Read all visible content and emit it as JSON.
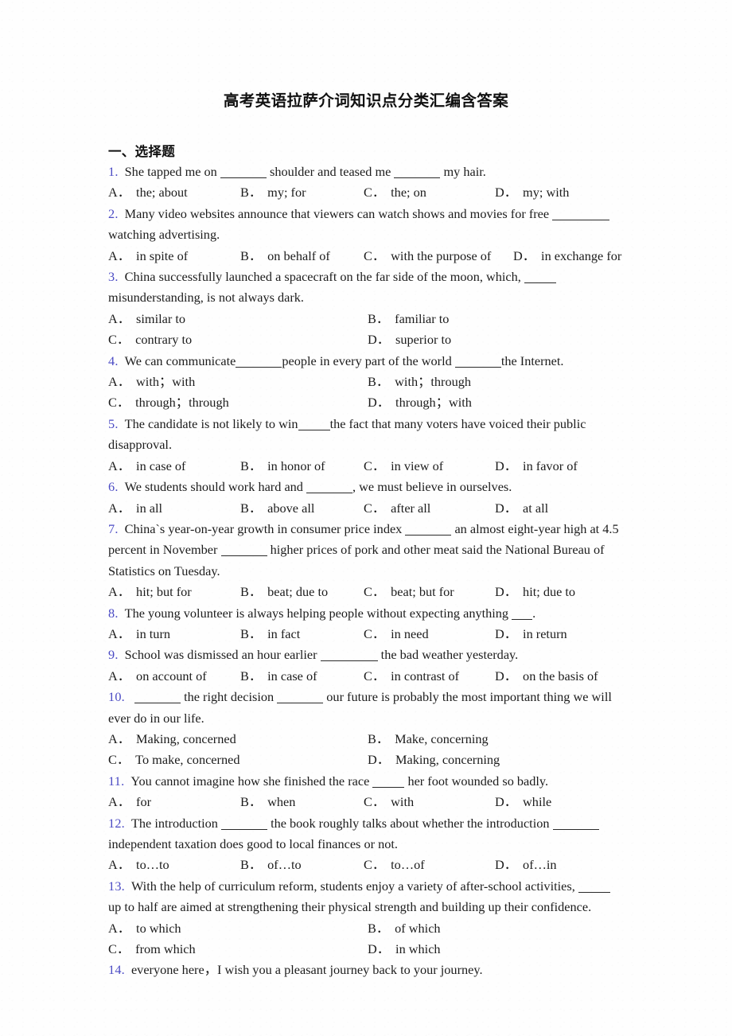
{
  "document": {
    "title": "高考英语拉萨介词知识点分类汇编含答案",
    "section_heading": "一、选择题"
  },
  "questions": [
    {
      "number": "1.",
      "stem_parts": [
        "She tapped me on ",
        " shoulder and teased me ",
        " my hair."
      ],
      "blanks": [
        "blank-m",
        "blank-m"
      ],
      "layout": "cols4",
      "options": [
        {
          "letter": "A．",
          "text": "the; about"
        },
        {
          "letter": "B．",
          "text": "my; for"
        },
        {
          "letter": "C．",
          "text": "the; on"
        },
        {
          "letter": "D．",
          "text": "my; with"
        }
      ]
    },
    {
      "number": "2.",
      "stem_parts": [
        "Many video websites announce that viewers can watch shows and movies for free ",
        " watching advertising."
      ],
      "blanks": [
        "blank-l"
      ],
      "layout": "cols4tight",
      "options": [
        {
          "letter": "A．",
          "text": "in spite of"
        },
        {
          "letter": "B．",
          "text": "on behalf of"
        },
        {
          "letter": "C．",
          "text": "with the purpose of"
        },
        {
          "letter": "D．",
          "text": "in exchange for"
        }
      ]
    },
    {
      "number": "3.",
      "stem_parts": [
        "China successfully launched a spacecraft on the far side of the moon, which, ",
        " misunderstanding, is not always dark."
      ],
      "blanks": [
        "blank-s"
      ],
      "layout": "cols2",
      "options": [
        {
          "letter": "A．",
          "text": "similar to"
        },
        {
          "letter": "B．",
          "text": "familiar to"
        },
        {
          "letter": "C．",
          "text": "contrary to"
        },
        {
          "letter": "D．",
          "text": "superior to"
        }
      ]
    },
    {
      "number": "4.",
      "stem_parts": [
        "We can communicate",
        "people in every part of the world ",
        "the Internet."
      ],
      "blanks": [
        "blank-m",
        "blank-m"
      ],
      "layout": "cols2",
      "options": [
        {
          "letter": "A．",
          "text": "with；with"
        },
        {
          "letter": "B．",
          "text": "with；through"
        },
        {
          "letter": "C．",
          "text": "through；through"
        },
        {
          "letter": "D．",
          "text": "through；with"
        }
      ]
    },
    {
      "number": "5.",
      "stem_parts": [
        "The candidate is not likely to win",
        "the fact that many voters have voiced their public disapproval."
      ],
      "blanks": [
        "blank-s"
      ],
      "layout": "cols4",
      "options": [
        {
          "letter": "A．",
          "text": "in case of"
        },
        {
          "letter": "B．",
          "text": "in honor of"
        },
        {
          "letter": "C．",
          "text": "in view of"
        },
        {
          "letter": "D．",
          "text": "in favor of"
        }
      ]
    },
    {
      "number": "6.",
      "stem_parts": [
        "We students should work hard and ",
        ", we must believe in ourselves."
      ],
      "blanks": [
        "blank-m"
      ],
      "layout": "cols4",
      "options": [
        {
          "letter": "A．",
          "text": "in all"
        },
        {
          "letter": "B．",
          "text": "above all"
        },
        {
          "letter": "C．",
          "text": "after all"
        },
        {
          "letter": "D．",
          "text": "at all"
        }
      ]
    },
    {
      "number": "7.",
      "stem_parts": [
        "China`s year-on-year growth in consumer price index ",
        " an almost eight-year high at 4.5 percent in November ",
        " higher prices of pork and other meat said the National Bureau of Statistics on Tuesday."
      ],
      "blanks": [
        "blank-m",
        "blank-m"
      ],
      "layout": "cols4",
      "options": [
        {
          "letter": "A．",
          "text": "hit; but for"
        },
        {
          "letter": "B．",
          "text": "beat; due to"
        },
        {
          "letter": "C．",
          "text": "beat; but for"
        },
        {
          "letter": "D．",
          "text": "hit; due to"
        }
      ]
    },
    {
      "number": "8.",
      "stem_parts": [
        "The young volunteer is always helping people without expecting anything ",
        "."
      ],
      "blanks": [
        "blank-xs"
      ],
      "layout": "cols4",
      "options": [
        {
          "letter": "A．",
          "text": "in turn"
        },
        {
          "letter": "B．",
          "text": "in fact"
        },
        {
          "letter": "C．",
          "text": "in need"
        },
        {
          "letter": "D．",
          "text": "in return"
        }
      ]
    },
    {
      "number": "9.",
      "stem_parts": [
        "School was dismissed an hour earlier ",
        " the bad weather yesterday."
      ],
      "blanks": [
        "blank-l"
      ],
      "layout": "cols4",
      "options": [
        {
          "letter": "A．",
          "text": "on account of"
        },
        {
          "letter": "B．",
          "text": "in case of"
        },
        {
          "letter": "C．",
          "text": "in contrast of"
        },
        {
          "letter": "D．",
          "text": "on the basis of"
        }
      ]
    },
    {
      "number": "10.",
      "stem_parts": [
        " ",
        " the right decision ",
        " our future is probably the most important thing we will ever do in our life."
      ],
      "blanks": [
        "blank-m",
        "blank-m"
      ],
      "layout": "cols2",
      "options": [
        {
          "letter": "A．",
          "text": "Making, concerned"
        },
        {
          "letter": "B．",
          "text": "Make, concerning"
        },
        {
          "letter": "C．",
          "text": "To make, concerned"
        },
        {
          "letter": "D．",
          "text": "Making, concerning"
        }
      ]
    },
    {
      "number": "11.",
      "stem_parts": [
        "You cannot imagine how she finished the race ",
        " her foot wounded so badly."
      ],
      "blanks": [
        "blank-s"
      ],
      "layout": "cols4",
      "options": [
        {
          "letter": "A．",
          "text": "for"
        },
        {
          "letter": "B．",
          "text": "when"
        },
        {
          "letter": "C．",
          "text": "with"
        },
        {
          "letter": "D．",
          "text": "while"
        }
      ]
    },
    {
      "number": "12.",
      "stem_parts": [
        "The introduction ",
        " the book roughly talks about whether the introduction ",
        " independent taxation does good to local finances or not."
      ],
      "blanks": [
        "blank-m",
        "blank-m"
      ],
      "layout": "cols4",
      "options": [
        {
          "letter": "A．",
          "text": "to…to"
        },
        {
          "letter": "B．",
          "text": "of…to"
        },
        {
          "letter": "C．",
          "text": "to…of"
        },
        {
          "letter": "D．",
          "text": "of…in"
        }
      ]
    },
    {
      "number": "13.",
      "stem_parts": [
        "With the help of curriculum reform, students enjoy a variety of after-school activities, ",
        " up to half are aimed at strengthening their physical strength and building up their confidence."
      ],
      "blanks": [
        "blank-s"
      ],
      "layout": "cols2",
      "options": [
        {
          "letter": "A．",
          "text": "to which"
        },
        {
          "letter": "B．",
          "text": "of which"
        },
        {
          "letter": "C．",
          "text": "from which"
        },
        {
          "letter": "D．",
          "text": "in which"
        }
      ]
    },
    {
      "number": "14.",
      "stem_parts": [
        "everyone here，I wish you a pleasant journey back to your journey."
      ],
      "blanks": [],
      "layout": "none",
      "options": []
    }
  ],
  "colors": {
    "question_number": "#4b4bc4",
    "body_text": "#1c1c1c",
    "page_background": "#fefefe"
  }
}
